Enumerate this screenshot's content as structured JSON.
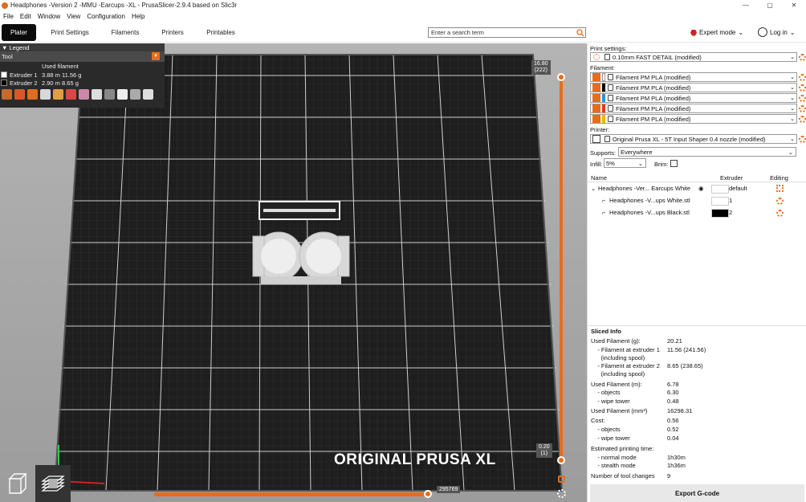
{
  "window": {
    "title": "Headphones -Version 2 -MMU -Earcups -XL - PrusaSlicer-2.9.4 based on Slic3r",
    "controls": [
      "—",
      "▢",
      "✕"
    ]
  },
  "menu": [
    "File",
    "Edit",
    "Window",
    "View",
    "Configuration",
    "Help"
  ],
  "tabs": [
    "Plater",
    "Print Settings",
    "Filaments",
    "Printers",
    "Printables"
  ],
  "search": {
    "placeholder": "Enter a search term"
  },
  "mode_label": "Expert mode",
  "login_label": "Log in",
  "legend": {
    "title": "Legend",
    "tool_label": "Tool",
    "used_filament_header": "Used filament",
    "extruders": [
      {
        "name": "Extruder 1",
        "value": "3.88 m  11.56 g",
        "color": "#ffffff"
      },
      {
        "name": "Extruder 2",
        "value": "2.90 m  8.65 g",
        "color": "#000000"
      }
    ]
  },
  "viewport": {
    "bed_label": "ORIGINAL PRUSA XL",
    "top_layer": {
      "height": "16.80",
      "layer": "(222)"
    },
    "bottom_layer": {
      "height": "0.20",
      "layer": "(1)"
    },
    "horizontal_value": "295769"
  },
  "right_panel": {
    "print_settings_label": "Print settings:",
    "print_settings_value": "0.10mm FAST DETAIL (modified)",
    "filament_label": "Filament:",
    "filaments": [
      {
        "name": "Filament PM PLA (modified)",
        "color": "#ffffff"
      },
      {
        "name": "Filament PM PLA (modified)",
        "color": "#000000"
      },
      {
        "name": "Filament PM PLA (modified)",
        "color": "#2e8fd8"
      },
      {
        "name": "Filament PM PLA (modified)",
        "color": "#e03a2a"
      },
      {
        "name": "Filament PM PLA (modified)",
        "color": "#f2b400"
      }
    ],
    "printer_label": "Printer:",
    "printer_value": "Original Prusa XL - 5T Input Shaper 0.4 nozzle (modified)",
    "supports_label": "Supports:",
    "supports_value": "Everywhere",
    "infill_label": "Infill:",
    "infill_value": "5%",
    "brim_label": "Brim:"
  },
  "object_list": {
    "headers": {
      "name": "Name",
      "extruder": "Extruder",
      "editing": "Editing"
    },
    "rows": [
      {
        "name": "Headphones -Ver... Earcups White",
        "extruder": "default",
        "color": "#ffffff"
      },
      {
        "name": "Headphones -V...ups White.stl",
        "extruder": "1",
        "color": "#ffffff"
      },
      {
        "name": "Headphones -V...ups Black.stl",
        "extruder": "2",
        "color": "#000000"
      }
    ]
  },
  "sliced_info": {
    "title": "Sliced Info",
    "rows": [
      {
        "k": "Used Filament (g):",
        "v": "20.21"
      },
      {
        "k": "    - Filament at extruder 1",
        "v": "11.56 (241.56)"
      },
      {
        "k": "      (including spool)",
        "v": ""
      },
      {
        "k": "    - Filament at extruder 2",
        "v": "8.65 (238.65)"
      },
      {
        "k": "      (including spool)",
        "v": ""
      },
      {
        "k": "Used Filament (m):",
        "v": "6.78"
      },
      {
        "k": "    - objects",
        "v": "6.30"
      },
      {
        "k": "    - wipe tower",
        "v": "0.48"
      },
      {
        "k": "Used Filament (mm³)",
        "v": "16298.31"
      },
      {
        "k": "Cost:",
        "v": "0.56"
      },
      {
        "k": "    - objects",
        "v": "0.52"
      },
      {
        "k": "    - wipe tower",
        "v": "0.04"
      },
      {
        "k": "Estimated printing time:",
        "v": ""
      },
      {
        "k": "    - normal mode",
        "v": "1h30m"
      },
      {
        "k": "    - stealth mode",
        "v": "1h36m"
      },
      {
        "k": "Number of tool changes",
        "v": "9"
      }
    ]
  },
  "export_label": "Export G-code",
  "colors": {
    "accent": "#e86c1e"
  }
}
